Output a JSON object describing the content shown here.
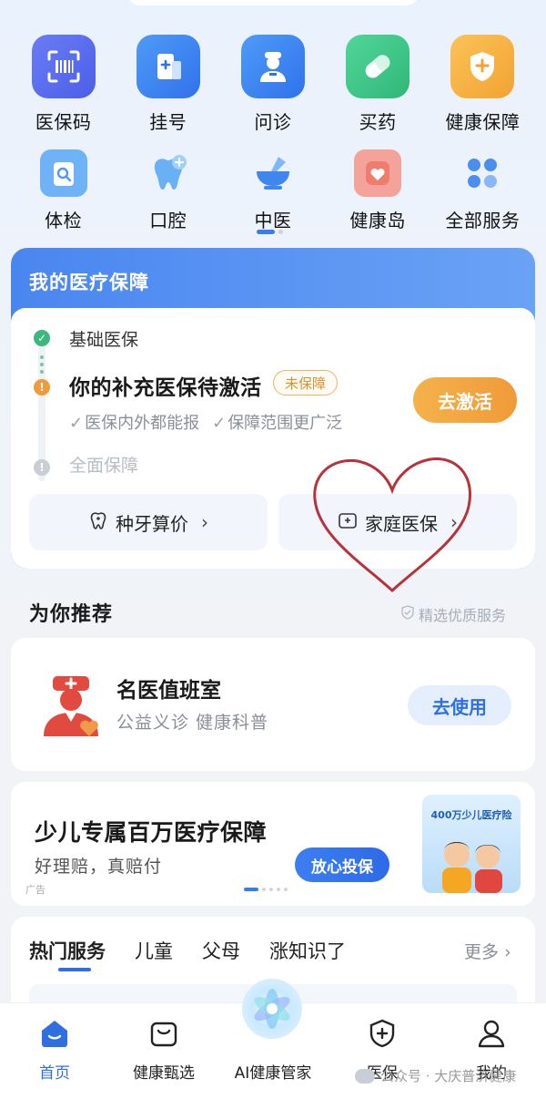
{
  "services_row1": [
    {
      "label": "医保码",
      "icon": "qr-code-icon",
      "color": "#5a6ff0"
    },
    {
      "label": "挂号",
      "icon": "register-icon",
      "color": "#3e86f3"
    },
    {
      "label": "问诊",
      "icon": "doctor-icon",
      "color": "#3e86f3"
    },
    {
      "label": "买药",
      "icon": "pill-icon",
      "color": "#36c487"
    },
    {
      "label": "健康保障",
      "icon": "shield-icon",
      "color": "#f5b03c"
    }
  ],
  "services_row2": [
    {
      "label": "体检",
      "icon": "clipboard-icon"
    },
    {
      "label": "口腔",
      "icon": "tooth-icon"
    },
    {
      "label": "中医",
      "icon": "mortar-icon"
    },
    {
      "label": "健康岛",
      "icon": "heart-home-icon"
    },
    {
      "label": "全部服务",
      "icon": "grid-icon"
    }
  ],
  "medical": {
    "title": "我的医疗保障",
    "basic": "基础医保",
    "supplement": "你的补充医保待激活",
    "tag": "未保障",
    "check1": "医保内外都能报",
    "check2": "保障范围更广泛",
    "full": "全面保障",
    "activate": "去激活",
    "dental": "种牙算价",
    "family": "家庭医保"
  },
  "recommend": {
    "heading": "为你推荐",
    "sub": "精选优质服务",
    "title": "名医值班室",
    "desc": "公益义诊 健康科普",
    "button": "去使用"
  },
  "ad": {
    "title": "少儿专属百万医疗保障",
    "desc": "好理赔，真赔付",
    "tag": "广告",
    "button": "放心投保",
    "image_text": "400万少儿医疗险"
  },
  "hot": {
    "tabs": [
      "热门服务",
      "儿童",
      "父母",
      "涨知识了"
    ],
    "more": "更多"
  },
  "nav": [
    {
      "label": "首页",
      "icon": "home-icon"
    },
    {
      "label": "健康甄选",
      "icon": "bag-icon"
    },
    {
      "label": "AI健康管家",
      "icon": "ai-orb-icon"
    },
    {
      "label": "医保",
      "icon": "shield-plus-icon"
    },
    {
      "label": "我的",
      "icon": "user-icon"
    }
  ],
  "watermark": "公众号 · 大庆普济健康",
  "colors": {
    "primary": "#2f6fe0",
    "orange": "#f09a3a",
    "heart": "#b8323a"
  }
}
